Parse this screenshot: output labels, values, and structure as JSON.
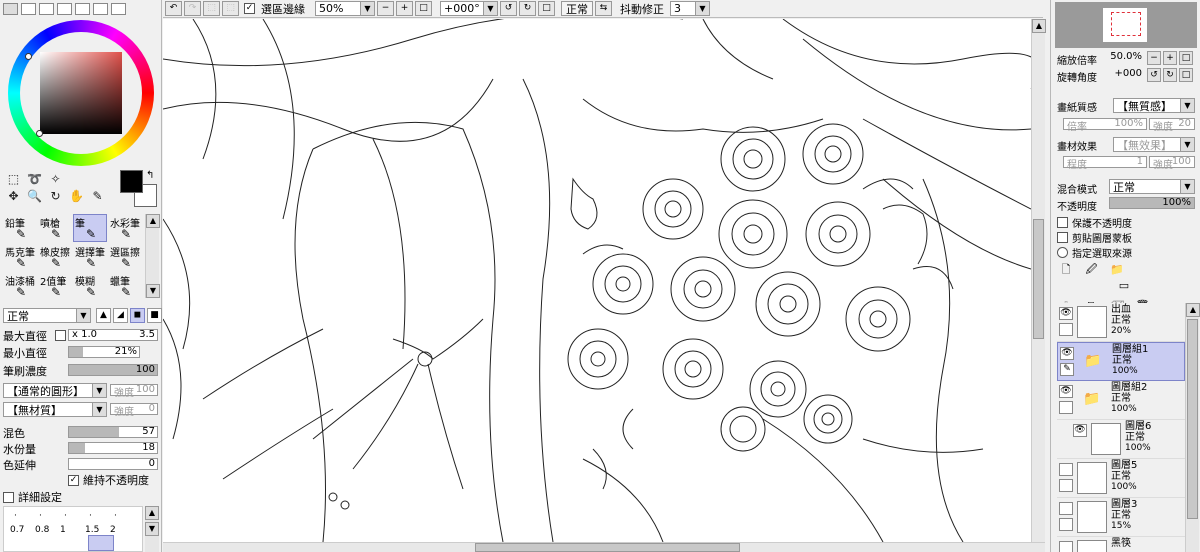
{
  "toolbar": {
    "stabilize_label": "選區邊緣",
    "zoom_value": "50%",
    "rotation_value": "+000°",
    "blend_mode_value": "正常",
    "shake_label": "抖動修正",
    "shake_value": "3"
  },
  "tools": {
    "brushes": [
      {
        "label": "鉛筆",
        "icon": "pencil-icon"
      },
      {
        "label": "噴槍",
        "icon": "airbrush-icon"
      },
      {
        "label": "筆",
        "icon": "brush-icon",
        "selected": true
      },
      {
        "label": "水彩筆",
        "icon": "watercolor-icon"
      },
      {
        "label": "馬克筆",
        "icon": "marker-icon"
      },
      {
        "label": "橡皮擦",
        "icon": "eraser-icon"
      },
      {
        "label": "選擇筆",
        "icon": "select-pen-icon"
      },
      {
        "label": "選區擦",
        "icon": "select-eraser-icon"
      },
      {
        "label": "油漆桶",
        "icon": "bucket-icon"
      },
      {
        "label": "2值筆",
        "icon": "binary-pen-icon"
      },
      {
        "label": "模糊",
        "icon": "blur-icon"
      },
      {
        "label": "蠟筆",
        "icon": "crayon-icon"
      }
    ],
    "brush_mode": "正常",
    "max_size_label": "最大直徑",
    "max_size_mult": "x 1.0",
    "max_size_value": "3.5",
    "min_size_label": "最小直徑",
    "min_size_value": "21%",
    "density_label": "筆刷濃度",
    "density_value": "100",
    "shape_select": "【通常的圓形】",
    "shape_strength_label": "強度",
    "shape_strength_value": "100",
    "texture_select": "【無材質】",
    "texture_strength_label": "強度",
    "texture_strength_value": "0",
    "blend_label": "混色",
    "blend_value": "57",
    "water_label": "水份量",
    "water_value": "18",
    "color_stretch_label": "色延伸",
    "color_stretch_value": "0",
    "keep_opacity_label": "維持不透明度",
    "detail_label": "詳細設定",
    "size_grid": [
      "0.7",
      "0.8",
      "1",
      "1.5",
      "2"
    ]
  },
  "navigator": {
    "zoom_label": "縮放倍率",
    "zoom_value": "50.0%",
    "rotate_label": "旋轉角度",
    "rotate_value": "+000"
  },
  "layer_props": {
    "paper_label": "畫紙質感",
    "paper_value": "【無質感】",
    "paper_rate_label": "倍率",
    "paper_rate_value": "100%",
    "paper_strength_label": "強度",
    "paper_strength_value": "20",
    "effect_label": "畫材效果",
    "effect_value": "【無效果】",
    "effect_degree_label": "程度",
    "effect_degree_value": "1",
    "effect_strength_label": "強度",
    "effect_strength_value": "100",
    "blend_label": "混合模式",
    "blend_value": "正常",
    "opacity_label": "不透明度",
    "opacity_value": "100%",
    "protect_label": "保護不透明度",
    "clip_label": "剪貼圖層蒙板",
    "select_source_label": "指定選取來源"
  },
  "layers": [
    {
      "name": "出血",
      "mode": "正常",
      "opacity": "20%",
      "type": "layer",
      "visible": true
    },
    {
      "name": "圖層組1",
      "mode": "正常",
      "opacity": "100%",
      "type": "folder",
      "visible": true,
      "selected": true
    },
    {
      "name": "圖層組2",
      "mode": "正常",
      "opacity": "100%",
      "type": "folder",
      "visible": true
    },
    {
      "name": "圖層6",
      "mode": "正常",
      "opacity": "100%",
      "type": "layer",
      "visible": true,
      "indent": true
    },
    {
      "name": "圖層5",
      "mode": "正常",
      "opacity": "100%",
      "type": "layer",
      "visible": false
    },
    {
      "name": "圖層3",
      "mode": "正常",
      "opacity": "15%",
      "type": "layer",
      "visible": false
    },
    {
      "name": "黑筷",
      "mode": "",
      "opacity": "",
      "type": "layer",
      "visible": false
    }
  ]
}
